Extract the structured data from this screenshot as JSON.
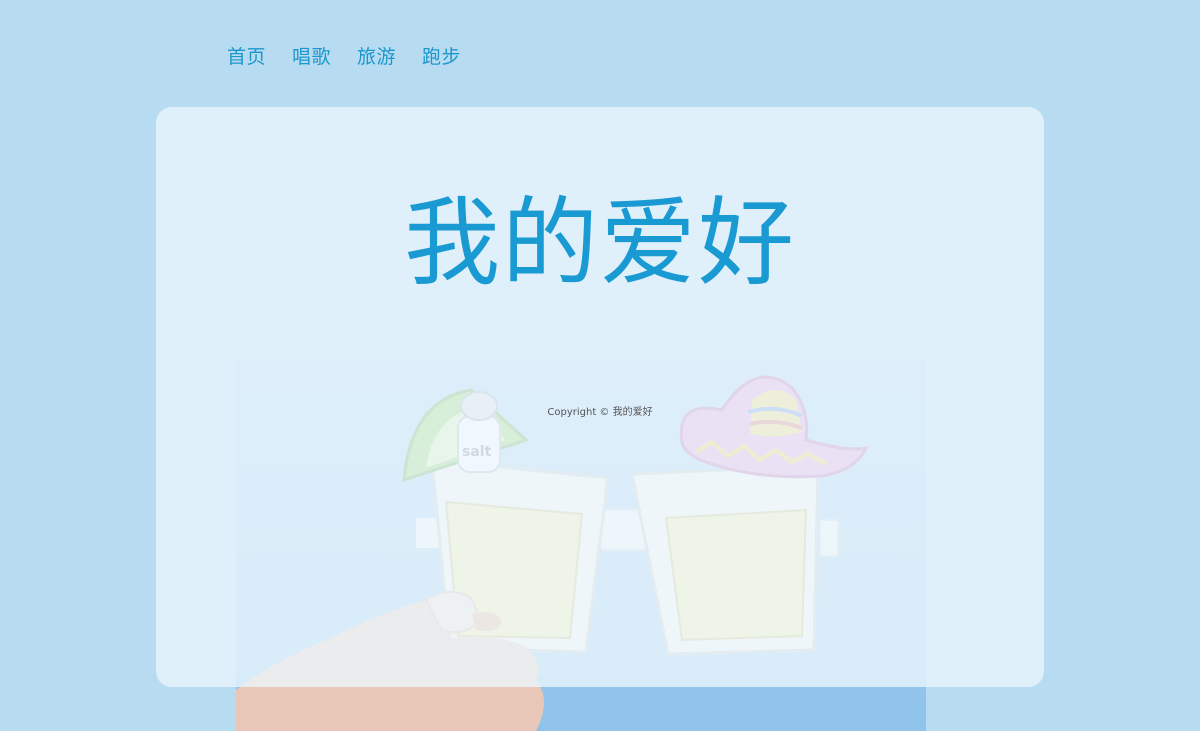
{
  "nav": {
    "items": [
      {
        "label": "首页"
      },
      {
        "label": "唱歌"
      },
      {
        "label": "旅游"
      },
      {
        "label": "跑步"
      }
    ]
  },
  "hero": {
    "title": "我的爱好"
  },
  "footer": {
    "copyright": "Copyright © 我的爱好"
  },
  "photo": {
    "salt_shaker_text": "salt"
  },
  "colors": {
    "background": "#b7dbf1",
    "accent": "#1a9ad2",
    "card": "#ecf6fc"
  }
}
